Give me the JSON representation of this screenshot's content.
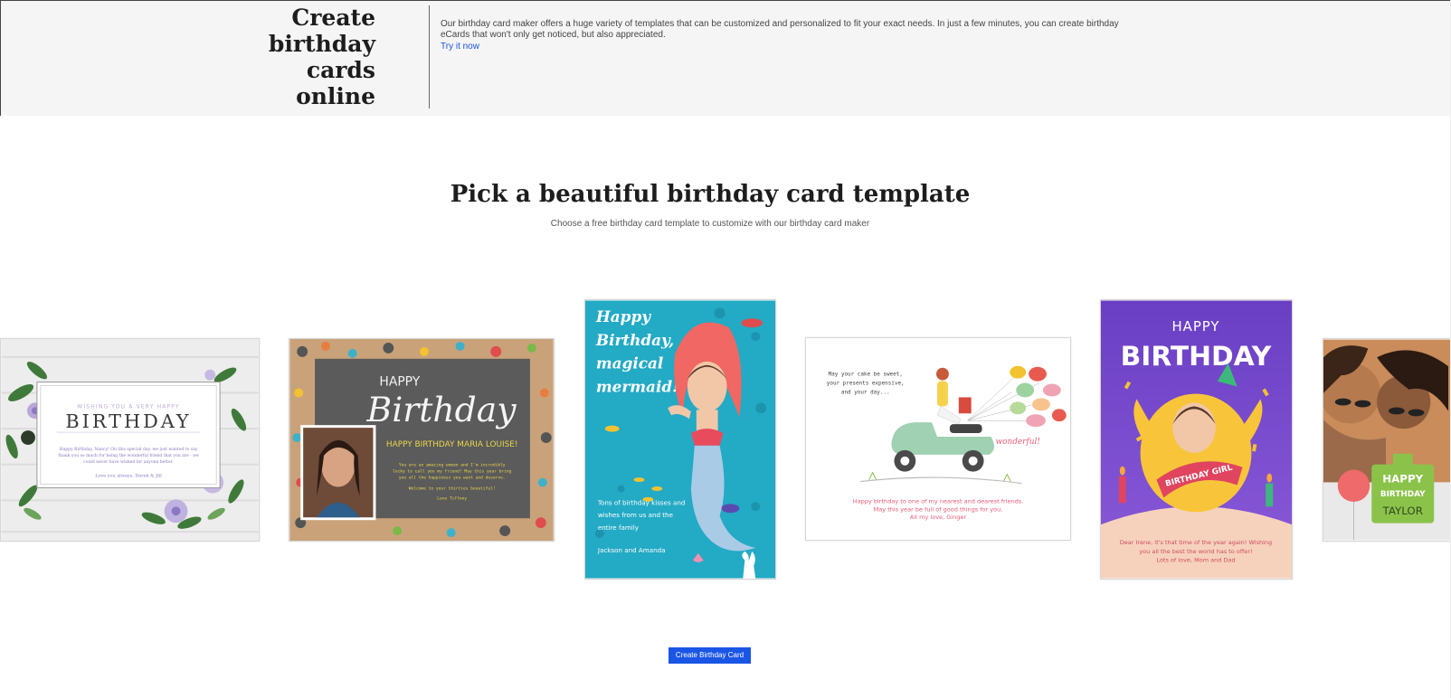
{
  "hero": {
    "title_lines": [
      "Create",
      "birthday",
      "cards",
      "online"
    ],
    "description": "Our birthday card maker offers a huge variety of templates that can be customized and personalized to fit your exact needs. In just a few minutes, you can create birthday eCards that won't only get noticed, but also appreciated.",
    "link_label": "Try it now"
  },
  "section": {
    "title": "Pick a beautiful birthday card template",
    "subtitle": "Choose a free birthday card template to customize with our birthday card maker"
  },
  "cards": [
    {
      "name": "Floral birthday card",
      "heading_small": "WISHING YOU A VERY HAPPY",
      "heading": "BIRTHDAY",
      "message_lines": [
        "Happy Birthday, Nancy! On this special day, we just wanted to say",
        "thank you so much for being the wonderful friend that you are - we",
        "could never have wished for anyone better."
      ],
      "signature": "Love you always, Derek & Jill"
    },
    {
      "name": "Chalkboard birthday card",
      "heading_small": "HAPPY",
      "heading": "Birthday",
      "subheading": "HAPPY BIRTHDAY MARIA LOUISE!",
      "message_lines": [
        "You are an amazing woman and I'm incredibly",
        "lucky to call you my friend! May this year bring",
        "you all the happiness you want and deserve."
      ],
      "extra_line": "Welcome to your thirties beautiful!",
      "signature": "Love Tiffany"
    },
    {
      "name": "Mermaid birthday card",
      "heading_lines": [
        "Happy",
        "Birthday,",
        "magical",
        "mermaid!"
      ],
      "message_lines": [
        "Tons of birthday kisses and",
        "wishes from us and the",
        "entire family"
      ],
      "signature": "Jackson and Amanda"
    },
    {
      "name": "Scooter balloon birthday card",
      "top_lines": [
        "May your cake be sweet,",
        "your presents expensive,",
        "and your day..."
      ],
      "accent_word": "wonderful!",
      "message_lines": [
        "Happy birthday to one of my nearest and dearest friends.",
        "May this year be full of good things for you.",
        "All my love, Ginger"
      ]
    },
    {
      "name": "Birthday girl chick card",
      "heading_small": "HAPPY",
      "heading": "BIRTHDAY",
      "ribbon": "BIRTHDAY GIRL",
      "message_lines": [
        "Dear Irene, it's that time of the year again! Wishing",
        "you all the best the world has to offer!",
        "Lots of love, Mom and Dad"
      ]
    },
    {
      "name": "Photo birthday card",
      "badge_lines": [
        "HAPPY",
        "BIRTHDAY"
      ],
      "badge_name": "TAYLOR"
    }
  ],
  "cta": {
    "label": "Create Birthday Card"
  },
  "colors": {
    "hero_bg": "#f5f5f5",
    "link": "#1a55d6",
    "cta_bg": "#1a55e6",
    "chalkboard": "#5b5b5b",
    "kraft": "#c9a27a",
    "mermaid_bg": "#23aac5",
    "purple": "#7a4bd1",
    "peach": "#f6d2bd",
    "badge_green": "#8bc34a"
  }
}
